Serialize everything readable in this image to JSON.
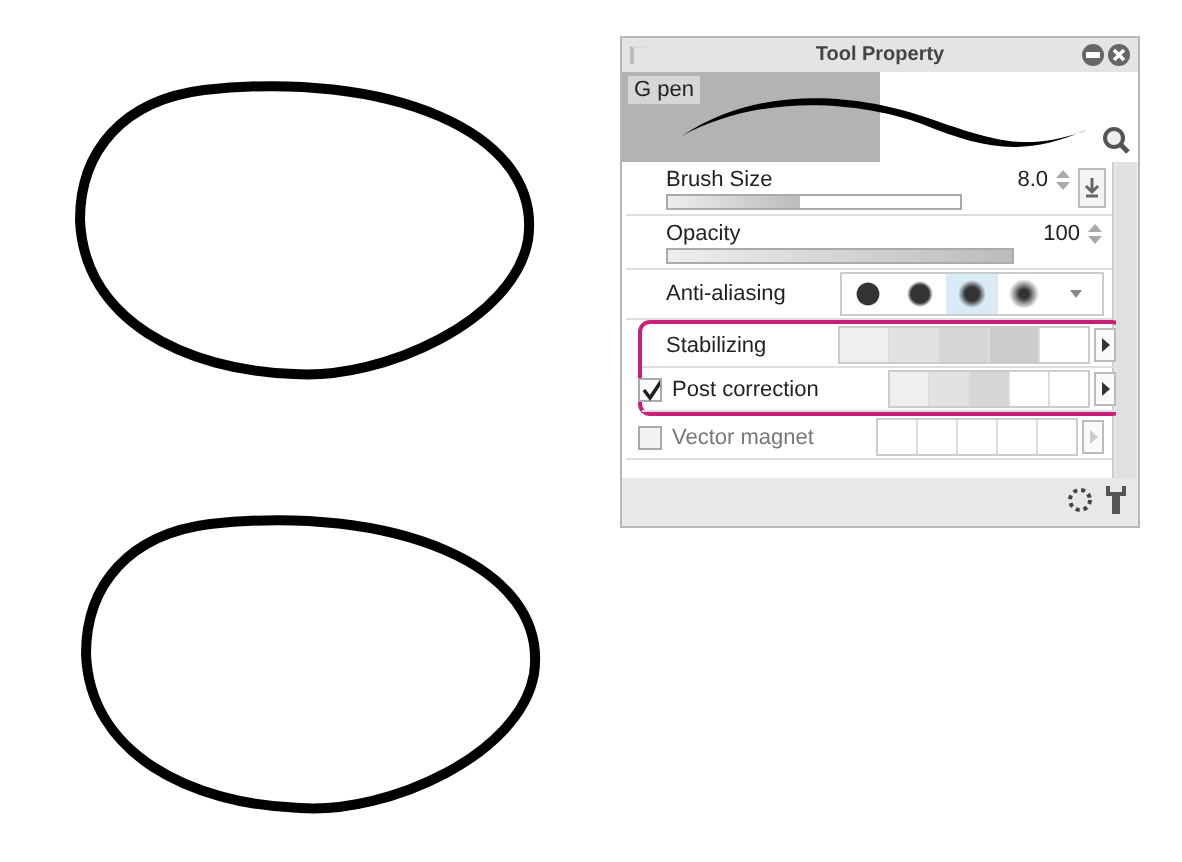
{
  "canvas": {
    "strokes": [
      {
        "kind": "oval"
      },
      {
        "kind": "oval"
      }
    ]
  },
  "panel": {
    "title": "Tool Property",
    "tool_name": "G pen",
    "properties": [
      {
        "kind": "slider",
        "label": "Brush Size",
        "level": 0.45,
        "value": "8.0"
      },
      {
        "kind": "slider",
        "label": "Opacity",
        "level": 1.0,
        "value": "100"
      },
      {
        "kind": "antialias",
        "label": "Anti-aliasing",
        "options": [
          {
            "selected": false
          },
          {
            "selected": false
          },
          {
            "selected": true
          },
          {
            "selected": false
          }
        ]
      },
      {
        "kind": "steps",
        "label": "Stabilizing",
        "level": 0.8,
        "highlighted": true
      },
      {
        "kind": "check-steps",
        "label": "Post correction",
        "checked": true,
        "disabled": false,
        "level": 0.6,
        "highlighted": true
      },
      {
        "kind": "check-steps",
        "label": "Vector magnet",
        "checked": false,
        "disabled": true,
        "highlighted": false
      }
    ]
  }
}
